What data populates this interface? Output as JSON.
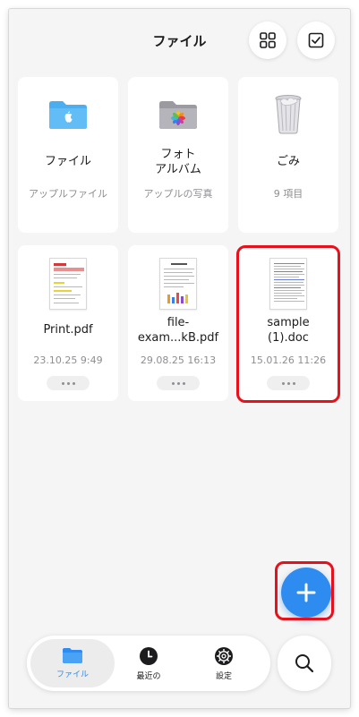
{
  "header": {
    "title": "ファイル"
  },
  "cards": [
    {
      "name": "ファイル",
      "meta": "アップルファイル",
      "icon": "blue-folder-icon"
    },
    {
      "name": "フォト\nアルバム",
      "meta": "アップルの写真",
      "icon": "photos-folder-icon"
    },
    {
      "name": "ごみ",
      "meta": "9 項目",
      "icon": "trash-icon"
    },
    {
      "name": "Print.pdf",
      "meta": "23.10.25 9:49",
      "icon": "pdf-thumbnail-icon"
    },
    {
      "name": "file-\nexam...kB.pdf",
      "meta": "29.08.25 16:13",
      "icon": "pdf-thumbnail-icon"
    },
    {
      "name": "sample\n(1).doc",
      "meta": "15.01.26 11:26",
      "icon": "doc-thumbnail-icon"
    }
  ],
  "tabbar": {
    "files_label": "ファイル",
    "recent_label": "最近の",
    "settings_label": "設定"
  },
  "colors": {
    "accent": "#2e8cf0",
    "highlight": "#e8101a",
    "secondary_text": "#8e8e93"
  }
}
